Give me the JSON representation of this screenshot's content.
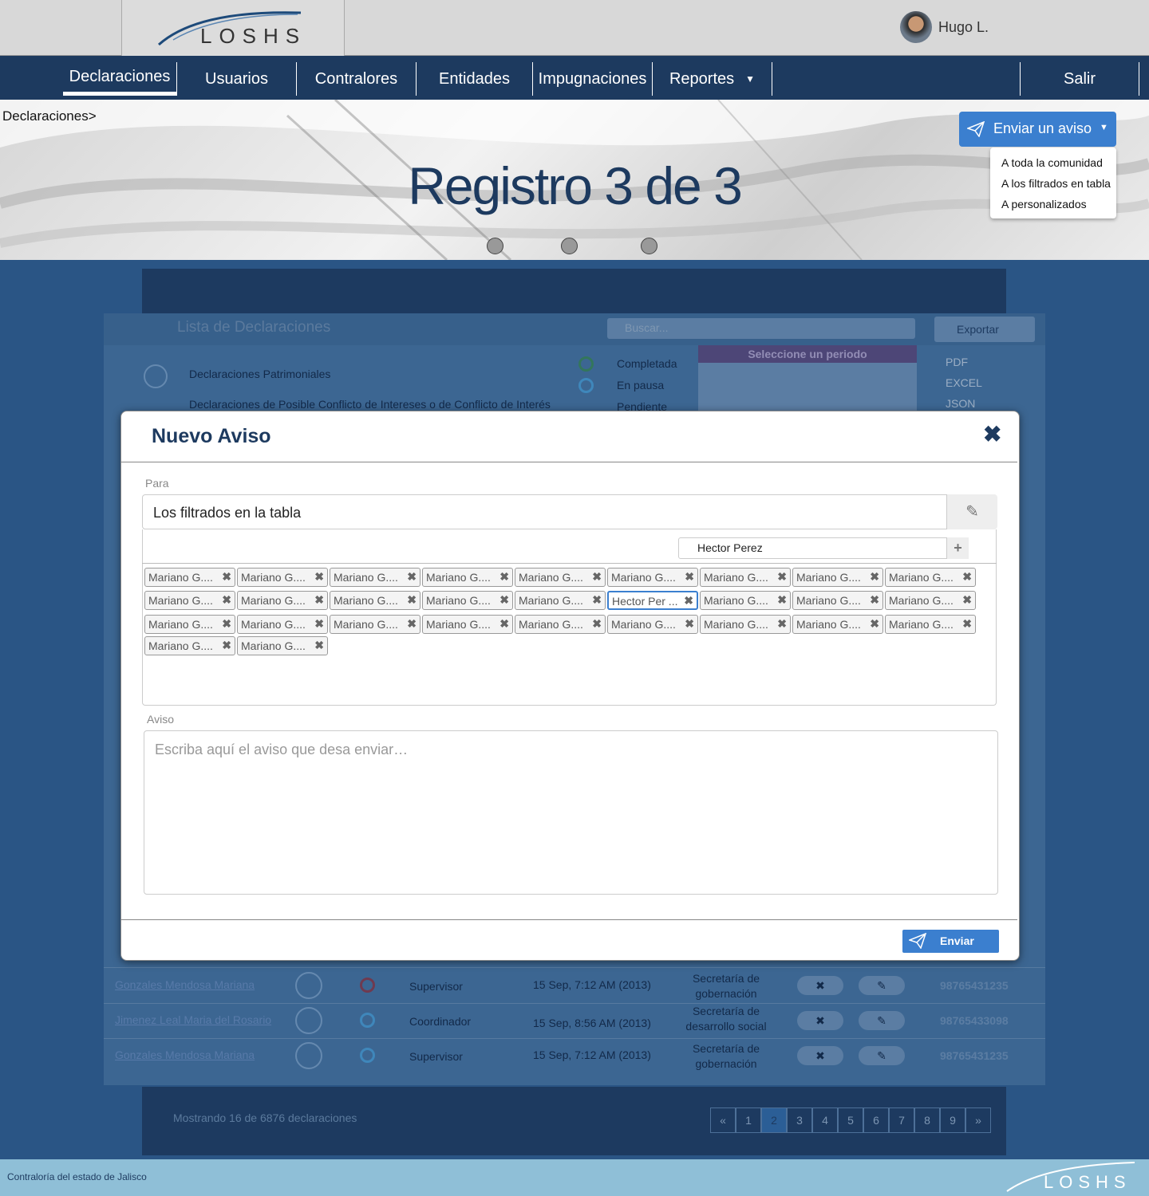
{
  "header": {
    "brand": "LOSHS",
    "user_name": "Hugo L."
  },
  "nav": {
    "items": [
      "Declaraciones",
      "Usuarios",
      "Contralores",
      "Entidades",
      "Impugnaciones",
      "Reportes"
    ],
    "logout": "Salir"
  },
  "hero": {
    "breadcrumb": "Declaraciones>",
    "title": "Registro 3 de 3",
    "send_button": "Enviar un aviso",
    "dropdown": [
      "A toda la comunidad",
      "A los filtrados en tabla",
      "A personalizados"
    ]
  },
  "background": {
    "list_title": "Lista de Declaraciones",
    "search_placeholder": "Buscar...",
    "export_label": "Exportar",
    "export_options": [
      "PDF",
      "EXCEL",
      "JSON"
    ],
    "legend_types": [
      "Declaraciones Patrimoniales",
      "Declaraciones de Posible Conflicto de Intereses o de Conflicto de Interés"
    ],
    "legend_status": [
      "Completada",
      "En pausa",
      "Pendiente"
    ],
    "period_label": "Seleccione un periodo",
    "rows": [
      {
        "name": "Gonzales Mendosa Mariana",
        "role": "Supervisor",
        "date": "15 Sep, 7:12 AM (2013)",
        "entity": "Secretaría de gobernación",
        "id": "98765431235"
      },
      {
        "name": "Jimenez Leal Maria del Rosario",
        "role": "Coordinador",
        "date": "15 Sep, 8:56 AM (2013)",
        "entity": "Secretaría de desarrollo social",
        "id": "98765433098"
      },
      {
        "name": "Gonzales Mendosa Mariana",
        "role": "Supervisor",
        "date": "15 Sep, 7:12 AM (2013)",
        "entity": "Secretaría de gobernación",
        "id": "98765431235"
      }
    ],
    "showing": "Mostrando 16 de 6876 declaraciones",
    "pages": [
      "«",
      "1",
      "2",
      "3",
      "4",
      "5",
      "6",
      "7",
      "8",
      "9",
      "»"
    ]
  },
  "modal": {
    "title": "Nuevo Aviso",
    "para_label": "Para",
    "para_value": "Los filtrados en la tabla",
    "recipient_input": "Hector Perez",
    "chips": [
      "Mariano G....",
      "Mariano G....",
      "Mariano G....",
      "Mariano G....",
      "Mariano G....",
      "Mariano G....",
      "Mariano G....",
      "Mariano G....",
      "Mariano G....",
      "Mariano G....",
      "Mariano G....",
      "Mariano G....",
      "Mariano G....",
      "Mariano G....",
      "Hector Per ...",
      "Mariano G....",
      "Mariano G....",
      "Mariano G....",
      "Mariano G....",
      "Mariano G....",
      "Mariano G....",
      "Mariano G....",
      "Mariano G....",
      "Mariano G....",
      "Mariano G....",
      "Mariano G....",
      "Mariano G....",
      "Mariano G....",
      "Mariano G...."
    ],
    "aviso_label": "Aviso",
    "aviso_placeholder": "Escriba aquí el aviso que desa enviar…",
    "send_label": "Enviar"
  },
  "footer": {
    "text": "Contraloría del estado de Jalisco",
    "brand": "LOSHS"
  },
  "colors": {
    "navy": "#1d3a5f",
    "accent": "#3b7fcf",
    "footer": "#8fbfd7"
  }
}
